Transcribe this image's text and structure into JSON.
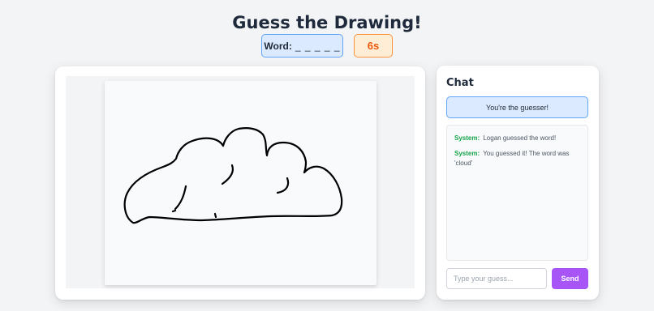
{
  "header": {
    "title": "Guess the Drawing!",
    "word_label": "Word:",
    "word_value": "_ _ _ _ _",
    "timer": "6s"
  },
  "canvas": {
    "stroke_color": "#000000",
    "background_color": "#f8fafc"
  },
  "chat": {
    "title": "Chat",
    "role_banner": "You're the guesser!",
    "messages": [
      {
        "sender": "System:",
        "text": "Logan guessed the word!"
      },
      {
        "sender": "System:",
        "text": "You guessed it! The word was 'cloud'"
      }
    ],
    "input_placeholder": "Type your guess...",
    "send_label": "Send"
  },
  "colors": {
    "accent": "#a855f7",
    "info_bg": "#dbeafe",
    "info_border": "#60a5fa",
    "timer_bg": "#ffedd5",
    "timer_text": "#ea580c",
    "system_sender": "#16a34a"
  }
}
